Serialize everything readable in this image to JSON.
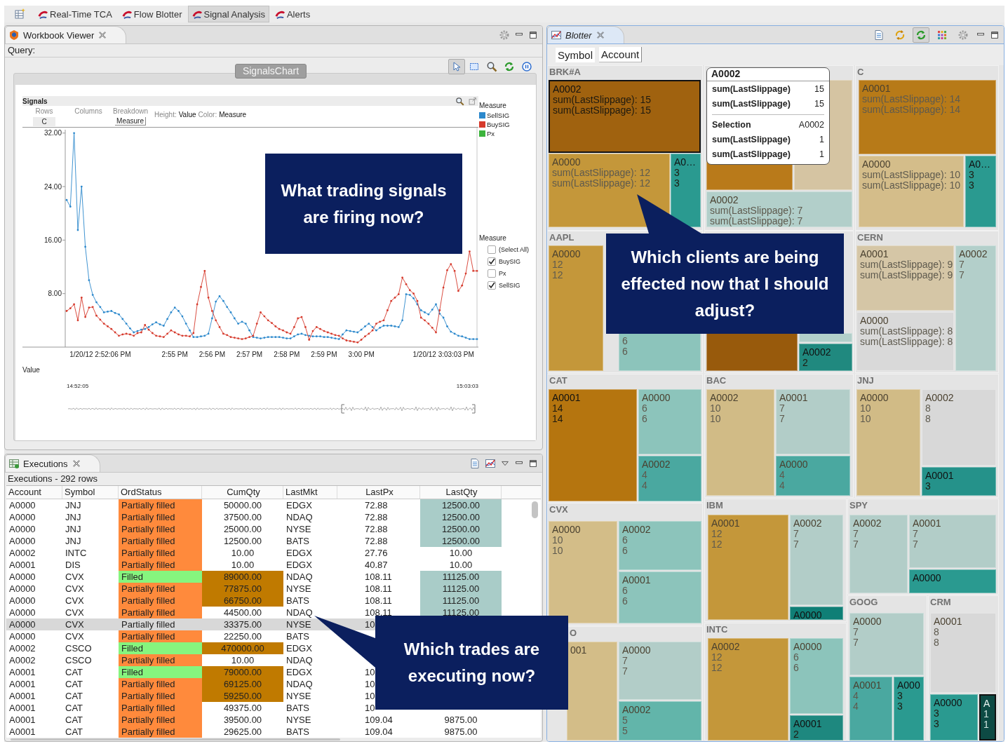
{
  "app_tabs": [
    {
      "label": "Real-Time TCA",
      "selected": false
    },
    {
      "label": "Flow Blotter",
      "selected": false
    },
    {
      "label": "Signal Analysis",
      "selected": true
    },
    {
      "label": "Alerts",
      "selected": false
    }
  ],
  "workbook": {
    "title": "Workbook Viewer",
    "query_label": "Query:",
    "chart_button": "SignalsChart",
    "toolbar": [
      {
        "kind": "pointer",
        "selected": true
      },
      {
        "kind": "marquee",
        "selected": false
      },
      {
        "kind": "search",
        "selected": false
      },
      {
        "kind": "refresh",
        "selected": false
      },
      {
        "kind": "pause",
        "selected": false
      }
    ],
    "chart": {
      "title": "Signals",
      "rows_label": "Rows",
      "rows_value": "C",
      "columns_label": "Columns",
      "breakdown_label": "Breakdown",
      "breakdown_value": "Measure",
      "height_label": "Height:",
      "height_value": "Value",
      "color_label": "Color:",
      "color_value": "Measure",
      "legend_title": "Measure",
      "filter_title": "Measure",
      "filter": [
        {
          "label": "(Select All)",
          "checked": false
        },
        {
          "label": "BuySIG",
          "checked": true
        },
        {
          "label": "Px",
          "checked": false
        },
        {
          "label": "SellSIG",
          "checked": true
        }
      ],
      "value_label": "Value",
      "overview_start": "14:52:05",
      "overview_end": "15:03:03",
      "chart_data": {
        "type": "line",
        "ylim": [
          0,
          32.5
        ],
        "categories": [
          null,
          null,
          null,
          null,
          null,
          null,
          null,
          null,
          null,
          "1/20/12 2:52:06 PM",
          null,
          null,
          null,
          null,
          null,
          null,
          null,
          null,
          null,
          null,
          null,
          null,
          null,
          null,
          null,
          null,
          null,
          null,
          null,
          "2:55 PM",
          null,
          null,
          null,
          null,
          null,
          null,
          null,
          null,
          null,
          "2:56 PM",
          null,
          null,
          null,
          null,
          null,
          null,
          null,
          null,
          null,
          "2:57 PM",
          null,
          null,
          null,
          null,
          null,
          null,
          null,
          null,
          null,
          "2:58 PM",
          null,
          null,
          null,
          null,
          null,
          null,
          null,
          null,
          null,
          "2:59 PM",
          null,
          null,
          null,
          null,
          null,
          null,
          null,
          null,
          null,
          "3:00 PM",
          null,
          null,
          null,
          null,
          null,
          null,
          null,
          null,
          null,
          null,
          null,
          null,
          null,
          null,
          null,
          null,
          null,
          null,
          null,
          null,
          null,
          "1/20/12 3:03:03 PM",
          null,
          null,
          null,
          null,
          null,
          null,
          null,
          null,
          null
        ],
        "yticks": [
          {
            "value": 8,
            "label": "8.00"
          },
          {
            "value": 16,
            "label": "16.00"
          },
          {
            "value": 24,
            "label": "24.00"
          },
          {
            "value": 32,
            "label": "32.00"
          }
        ],
        "series": [
          {
            "name": "SellSIG",
            "color": "#2b88cc",
            "values": [
              22,
              21,
              32,
              17.5,
              24,
              15,
              10,
              7.8,
              6.7,
              6,
              5.2,
              5.3,
              5.4,
              5.1,
              4.9,
              4.2,
              3.5,
              2.8,
              2.2,
              2.4,
              2.6,
              2.7,
              3,
              3.4,
              3.7,
              3.4,
              3.2,
              4.2,
              5.2,
              5.9,
              5.4,
              4.6,
              3.5,
              2.5,
              1.5,
              1.5,
              1.6,
              1.7,
              2,
              4.3,
              6.8,
              7.6,
              6.9,
              6,
              5.2,
              4.3,
              3.5,
              3.8,
              3.5,
              2.5,
              1.5,
              1.4,
              1.3,
              1.4,
              1.5,
              1.5,
              1.5,
              1.5,
              1.4,
              1.3,
              1.3,
              1.6,
              1.9,
              2,
              1.8,
              1.7,
              1.6,
              1.6,
              1.6,
              1.5,
              1.5,
              1.4,
              1.3,
              1.2,
              1.9,
              2.5,
              2.4,
              2.3,
              2.2,
              2.6,
              3.1,
              3.5,
              3,
              2.5,
              2.9,
              3.2,
              3.2,
              3.2,
              3.1,
              3,
              4,
              7.9,
              7.8,
              7.3,
              6.4,
              5.5,
              5.2,
              4.9,
              5.6,
              6.4,
              5.0,
              4.4,
              3.1,
              2.3,
              2,
              1.7,
              1.6,
              1.4,
              1.2,
              1.2,
              1.2
            ]
          },
          {
            "name": "BuySIG",
            "color": "#d63a2c",
            "values": [
              5.4,
              5.8,
              6.4,
              4,
              7.4,
              4.5,
              5.9,
              6,
              4.7,
              4.1,
              3.5,
              3.1,
              2.7,
              2.2,
              1.7,
              1.9,
              2,
              1.9,
              1.7,
              2.1,
              2.2,
              3.3,
              2.6,
              2.1,
              1.7,
              1.6,
              1.5,
              2,
              2.5,
              2.2,
              1.9,
              1.7,
              1.7,
              1.6,
              2.1,
              6.4,
              9,
              11.4,
              7.4,
              5.4,
              4,
              3,
              2,
              1.8,
              1.5,
              1.4,
              1.3,
              1.2,
              1.3,
              1.5,
              1.7,
              3.5,
              5.2,
              4.6,
              4,
              3.6,
              3.1,
              2.7,
              2.5,
              2.2,
              2,
              3,
              4.3,
              4.5,
              3,
              1.1,
              2.4,
              3,
              2.7,
              2.4,
              2.2,
              2,
              1.8,
              1.7,
              1.3,
              1,
              0.9,
              0.8,
              0.7,
              1.1,
              1.6,
              2,
              2.5,
              3.5,
              3.8,
              4,
              5.5,
              6.9,
              7.4,
              7.9,
              10.4,
              9.4,
              8.5,
              8.0,
              6.9,
              4.4,
              4,
              3.5,
              2.9,
              2.2,
              5.5,
              8.9,
              11.5,
              12.4,
              11.4,
              8.4,
              9.2,
              11,
              14.3,
              11.4,
              11.4
            ]
          },
          {
            "name": "Px",
            "color": "#3cb43c",
            "values": [
              null,
              null,
              null,
              null,
              null,
              null,
              null,
              null,
              null,
              null,
              null,
              null,
              null,
              null,
              null,
              null,
              null,
              null,
              null,
              null,
              null,
              null,
              null,
              null,
              null,
              null,
              null,
              null,
              null,
              null,
              null,
              null,
              null,
              null,
              null,
              null,
              null,
              null,
              null,
              null,
              null,
              null,
              null,
              null,
              null,
              null,
              null,
              null,
              null,
              null,
              null,
              null,
              null,
              null,
              null,
              null,
              null,
              null,
              null,
              null,
              null,
              null,
              null,
              null,
              null,
              null,
              null,
              null,
              null,
              null,
              null,
              null,
              null,
              null,
              null,
              null,
              null,
              null,
              null,
              null,
              null,
              null,
              null,
              null,
              null,
              null,
              null,
              null,
              null,
              null,
              null,
              null,
              null,
              null,
              null,
              null,
              null,
              null,
              null,
              null,
              null,
              null,
              null,
              null,
              null,
              null,
              null,
              null,
              null,
              null,
              null
            ]
          }
        ]
      }
    }
  },
  "executions": {
    "title": "Executions",
    "caption": "Executions - 292 rows",
    "columns": [
      "Account",
      "Symbol",
      "OrdStatus",
      "CumQty",
      "LastMkt",
      "LastPx",
      "LastQty"
    ],
    "rows": [
      {
        "selected": false,
        "cells": [
          {
            "text": "A0000"
          },
          {
            "text": "JNJ"
          },
          {
            "text": "Partially filled",
            "color": "#ff8a3c"
          },
          {
            "text": "50000.00"
          },
          {
            "text": "EDGX"
          },
          {
            "text": "72.88"
          },
          {
            "text": "12500.00",
            "color": "#a9ccc8"
          }
        ]
      },
      {
        "selected": false,
        "cells": [
          {
            "text": "A0000"
          },
          {
            "text": "JNJ"
          },
          {
            "text": "Partially filled",
            "color": "#ff8a3c"
          },
          {
            "text": "37500.00"
          },
          {
            "text": "NDAQ"
          },
          {
            "text": "72.88"
          },
          {
            "text": "12500.00",
            "color": "#a9ccc8"
          }
        ]
      },
      {
        "selected": false,
        "cells": [
          {
            "text": "A0000"
          },
          {
            "text": "JNJ"
          },
          {
            "text": "Partially filled",
            "color": "#ff8a3c"
          },
          {
            "text": "25000.00"
          },
          {
            "text": "NYSE"
          },
          {
            "text": "72.88"
          },
          {
            "text": "12500.00",
            "color": "#a9ccc8"
          }
        ]
      },
      {
        "selected": false,
        "cells": [
          {
            "text": "A0000"
          },
          {
            "text": "JNJ"
          },
          {
            "text": "Partially filled",
            "color": "#ff8a3c"
          },
          {
            "text": "12500.00"
          },
          {
            "text": "BATS"
          },
          {
            "text": "72.88"
          },
          {
            "text": "12500.00",
            "color": "#a9ccc8"
          }
        ]
      },
      {
        "selected": false,
        "cells": [
          {
            "text": "A0002"
          },
          {
            "text": "INTC"
          },
          {
            "text": "Partially filled",
            "color": "#ff8a3c"
          },
          {
            "text": "10.00"
          },
          {
            "text": "EDGX"
          },
          {
            "text": "27.76"
          },
          {
            "text": "10.00"
          }
        ]
      },
      {
        "selected": false,
        "cells": [
          {
            "text": "A0001"
          },
          {
            "text": "DIS"
          },
          {
            "text": "Partially filled",
            "color": "#ff8a3c"
          },
          {
            "text": "10.00"
          },
          {
            "text": "EDGX"
          },
          {
            "text": "40.87"
          },
          {
            "text": "10.00"
          }
        ]
      },
      {
        "selected": false,
        "cells": [
          {
            "text": "A0000"
          },
          {
            "text": "CVX"
          },
          {
            "text": "Filled",
            "color": "#86f57e"
          },
          {
            "text": "89000.00",
            "color": "#c07a00"
          },
          {
            "text": "NDAQ"
          },
          {
            "text": "108.11"
          },
          {
            "text": "11125.00",
            "color": "#a9ccc8"
          }
        ]
      },
      {
        "selected": false,
        "cells": [
          {
            "text": "A0000"
          },
          {
            "text": "CVX"
          },
          {
            "text": "Partially filled",
            "color": "#ff8a3c"
          },
          {
            "text": "77875.00",
            "color": "#c07a00"
          },
          {
            "text": "NYSE"
          },
          {
            "text": "108.11"
          },
          {
            "text": "11125.00",
            "color": "#a9ccc8"
          }
        ]
      },
      {
        "selected": false,
        "cells": [
          {
            "text": "A0000"
          },
          {
            "text": "CVX"
          },
          {
            "text": "Partially filled",
            "color": "#ff8a3c"
          },
          {
            "text": "66750.00",
            "color": "#c07a00"
          },
          {
            "text": "BATS"
          },
          {
            "text": "108.11"
          },
          {
            "text": "11125.00",
            "color": "#a9ccc8"
          }
        ]
      },
      {
        "selected": false,
        "cells": [
          {
            "text": "A0000"
          },
          {
            "text": "CVX"
          },
          {
            "text": "Partially filled",
            "color": "#ff8a3c"
          },
          {
            "text": "44500.00"
          },
          {
            "text": "NDAQ"
          },
          {
            "text": "108.11"
          },
          {
            "text": "11125.00",
            "color": "#a9ccc8"
          }
        ]
      },
      {
        "selected": true,
        "cells": [
          {
            "text": "A0000"
          },
          {
            "text": "CVX"
          },
          {
            "text": "Partially filled"
          },
          {
            "text": "33375.00"
          },
          {
            "text": "NYSE"
          },
          {
            "text": "10"
          },
          null
        ]
      },
      {
        "selected": false,
        "cells": [
          {
            "text": "A0000"
          },
          {
            "text": "CVX"
          },
          {
            "text": "Partially filled",
            "color": "#ff8a3c"
          },
          {
            "text": "22250.00"
          },
          {
            "text": "BATS"
          },
          null,
          null
        ]
      },
      {
        "selected": false,
        "cells": [
          {
            "text": "A0002"
          },
          {
            "text": "CSCO"
          },
          {
            "text": "Filled",
            "color": "#86f57e"
          },
          {
            "text": "470000.00",
            "color": "#c07a00"
          },
          {
            "text": "EDGX"
          },
          null,
          null
        ]
      },
      {
        "selected": false,
        "cells": [
          {
            "text": "A0002"
          },
          {
            "text": "CSCO"
          },
          {
            "text": "Partially filled",
            "color": "#ff8a3c"
          },
          {
            "text": "10.00"
          },
          {
            "text": "NDAQ"
          },
          null,
          null
        ]
      },
      {
        "selected": false,
        "cells": [
          {
            "text": "A0001"
          },
          {
            "text": "CAT"
          },
          {
            "text": "Filled",
            "color": "#86f57e"
          },
          {
            "text": "79000.00",
            "color": "#c07a00"
          },
          {
            "text": "EDGX"
          },
          {
            "text": "10"
          },
          null
        ]
      },
      {
        "selected": false,
        "cells": [
          {
            "text": "A0001"
          },
          {
            "text": "CAT"
          },
          {
            "text": "Partially filled",
            "color": "#ff8a3c"
          },
          {
            "text": "69125.00",
            "color": "#c07a00"
          },
          {
            "text": "NDAQ"
          },
          {
            "text": "10"
          },
          null
        ]
      },
      {
        "selected": false,
        "cells": [
          {
            "text": "A0001"
          },
          {
            "text": "CAT"
          },
          {
            "text": "Partially filled",
            "color": "#ff8a3c"
          },
          {
            "text": "59250.00",
            "color": "#c07a00"
          },
          {
            "text": "NYSE"
          },
          {
            "text": "10"
          },
          null
        ]
      },
      {
        "selected": false,
        "cells": [
          {
            "text": "A0001"
          },
          {
            "text": "CAT"
          },
          {
            "text": "Partially filled",
            "color": "#ff8a3c"
          },
          {
            "text": "49375.00"
          },
          {
            "text": "BATS"
          },
          {
            "text": "10"
          },
          null
        ]
      },
      {
        "selected": false,
        "cells": [
          {
            "text": "A0001"
          },
          {
            "text": "CAT"
          },
          {
            "text": "Partially filled",
            "color": "#ff8a3c"
          },
          {
            "text": "39500.00"
          },
          {
            "text": "NYSE"
          },
          {
            "text": "109.04"
          },
          {
            "text": "9875.00"
          }
        ]
      },
      {
        "selected": false,
        "cells": [
          {
            "text": "A0001"
          },
          {
            "text": "CAT"
          },
          {
            "text": "Partially filled",
            "color": "#ff8a3c"
          },
          {
            "text": "29625.00"
          },
          {
            "text": "BATS"
          },
          {
            "text": "109.04"
          },
          {
            "text": "9875.00"
          }
        ]
      }
    ]
  },
  "blotter": {
    "title": "Blotter",
    "toolbar": [
      {
        "kind": "layout",
        "selected": false
      },
      {
        "kind": "sync",
        "selected": false
      },
      {
        "kind": "refresh",
        "selected": true
      },
      {
        "kind": "colors",
        "selected": false
      },
      {
        "kind": "settings",
        "selected": false
      }
    ],
    "levels": [
      "Symbol",
      "Account"
    ],
    "tooltip": {
      "title": "A0002",
      "top_rows": [
        {
          "label": "sum(LastSlippage)",
          "value": "15"
        },
        {
          "label": "sum(LastSlippage)",
          "value": "15"
        }
      ],
      "selection_label": "Selection",
      "selection_value": "A0002",
      "bottom_rows": [
        {
          "label": "sum(LastSlippage)",
          "value": "1"
        },
        {
          "label": "sum(LastSlippage)",
          "value": "1"
        }
      ]
    },
    "groups": [
      {
        "name": "BRK#A",
        "tiles": [
          {
            "label": "A0002",
            "values": [
              "sum(LastSlippage): 15",
              "sum(LastSlippage): 15"
            ],
            "color": "#a0620f",
            "selected": true
          },
          {
            "label": "A0000",
            "values": [
              "sum(LastSlippage): 12",
              "sum(LastSlippage): 12"
            ],
            "color": "#c4973a",
            "selected": false
          },
          {
            "label": "A0…",
            "values": [
              "3",
              "3"
            ],
            "color": "#2a9a90",
            "selected": false
          }
        ]
      },
      {
        "tiles": [
          {
            "color": "#b97a1a",
            "selected": false
          },
          {
            "color": "#d5c4a2",
            "selected": false
          },
          {
            "label": "A0002",
            "values": [
              "sum(LastSlippage): 7",
              "sum(LastSlippage): 7"
            ],
            "color": "#b2cfca",
            "selected": false
          }
        ]
      },
      {
        "name": "C",
        "tiles": [
          {
            "label": "A0001",
            "values": [
              "sum(LastSlippage): 14",
              "sum(LastSlippage): 14"
            ],
            "color": "#b77a18",
            "selected": false
          },
          {
            "label": "A0000",
            "values": [
              "sum(LastSlippage): 10",
              "sum(LastSlippage): 10"
            ],
            "color": "#d4bd8a",
            "selected": false
          },
          {
            "label": "A0…",
            "values": [
              "3",
              "3"
            ],
            "color": "#2a9a90",
            "selected": false
          }
        ]
      },
      {
        "name": "AAPL",
        "tiles": [
          {
            "label": "A0000",
            "values": [
              "12",
              "12"
            ],
            "color": "#c4973a",
            "selected": false
          },
          {
            "values": [
              "6",
              "6"
            ],
            "color": "#8cc4bb",
            "selected": false
          }
        ]
      },
      {
        "tiles": [
          {
            "color": "#985a0c",
            "selected": false
          },
          {
            "color": "#b2cfca",
            "selected": false
          },
          {
            "label": "A0002",
            "values": [
              "2"
            ],
            "color": "#20897f",
            "selected": false
          }
        ]
      },
      {
        "name": "CERN",
        "tiles": [
          {
            "label": "A0001",
            "values": [
              "sum(LastSlippage): 9",
              "sum(LastSlippage): 9"
            ],
            "color": "#d5c6a6",
            "selected": false
          },
          {
            "label": "A0000",
            "values": [
              "sum(LastSlippage): 8",
              "sum(LastSlippage): 8"
            ],
            "color": "#d9d9d9",
            "selected": false
          },
          {
            "label": "A0002",
            "values": [
              "7",
              "7"
            ],
            "color": "#b3cfca",
            "selected": false
          }
        ]
      },
      {
        "name": "CAT",
        "tiles": [
          {
            "label": "A0001",
            "values": [
              "14",
              "14"
            ],
            "color": "#b5750f",
            "selected": false
          },
          {
            "label": "A0000",
            "values": [
              "6",
              "6"
            ],
            "color": "#8cc4bb",
            "selected": false
          },
          {
            "label": "A0002",
            "values": [
              "4",
              "4"
            ],
            "color": "#4aa8a0",
            "selected": false
          }
        ]
      },
      {
        "name": "BAC",
        "tiles": [
          {
            "label": "A0002",
            "values": [
              "10",
              "10"
            ],
            "color": "#d1bb86",
            "selected": false
          },
          {
            "label": "A0001",
            "values": [
              "7",
              "7"
            ],
            "color": "#b2cdc8",
            "selected": false
          },
          {
            "label": "A0000",
            "values": [
              "4",
              "4"
            ],
            "color": "#4aa8a0",
            "selected": false
          }
        ]
      },
      {
        "name": "JNJ",
        "tiles": [
          {
            "label": "A0000",
            "values": [
              "10",
              "10"
            ],
            "color": "#d1bb86",
            "selected": false
          },
          {
            "label": "A0002",
            "values": [
              "8",
              "8"
            ],
            "color": "#d8d8d8",
            "selected": false
          },
          {
            "label": "A0001",
            "values": [
              "3"
            ],
            "color": "#25928a",
            "selected": false
          }
        ]
      },
      {
        "name": "CVX",
        "tiles": [
          {
            "label": "A0000",
            "values": [
              "10",
              "10"
            ],
            "color": "#d3bd88",
            "selected": false
          },
          {
            "label": "A0002",
            "values": [
              "6",
              "6"
            ],
            "color": "#8cc4bb",
            "selected": false
          },
          {
            "label": "A0001",
            "values": [
              "6",
              "6"
            ],
            "color": "#8cc4bb",
            "selected": false
          }
        ]
      },
      {
        "name": "O",
        "tiles": [
          {
            "label": "001",
            "color": "#d3bd88",
            "selected": false
          },
          {
            "label": "A0000",
            "values": [
              "7",
              "7"
            ],
            "color": "#b2cdc8",
            "selected": false
          },
          {
            "label": "A0002",
            "values": [
              "5",
              "5"
            ],
            "color": "#62b5aa",
            "selected": false
          }
        ]
      },
      {
        "name": "IBM",
        "tiles": [
          {
            "label": "A0001",
            "values": [
              "12",
              "12"
            ],
            "color": "#c4973a",
            "selected": false
          },
          {
            "label": "A0002",
            "values": [
              "7",
              "7"
            ],
            "color": "#b2cdc8",
            "selected": false
          },
          {
            "label": "A0000",
            "color": "#0f7f76",
            "selected": false
          }
        ]
      },
      {
        "name": "INTC",
        "tiles": [
          {
            "label": "A0002",
            "values": [
              "12",
              "12"
            ],
            "color": "#c4973a",
            "selected": false
          },
          {
            "label": "A0000",
            "values": [
              "6",
              "6"
            ],
            "color": "#8cc4bb",
            "selected": false
          },
          {
            "label": "A0001",
            "values": [
              "2"
            ],
            "color": "#1e887f",
            "selected": false
          }
        ]
      },
      {
        "name": "SPY",
        "tiles": [
          {
            "label": "A0002",
            "values": [
              "7",
              "7"
            ],
            "color": "#b2cdc8",
            "selected": false
          },
          {
            "label": "A0001",
            "values": [
              "7",
              "7"
            ],
            "color": "#b2cdc8",
            "selected": false
          },
          {
            "label": "A0000",
            "color": "#2a9a90",
            "selected": false
          }
        ]
      },
      {
        "name": "GOOG",
        "tiles": [
          {
            "label": "A0000",
            "values": [
              "7",
              "7"
            ],
            "color": "#b2cdc8",
            "selected": false
          },
          {
            "label": "A0001",
            "values": [
              "4",
              "4"
            ],
            "color": "#4aa8a0",
            "selected": false
          },
          {
            "label": "A000",
            "values": [
              "3",
              "3"
            ],
            "color": "#2a9a90",
            "selected": false
          }
        ]
      },
      {
        "name": "CRM",
        "tiles": [
          {
            "label": "A0001",
            "values": [
              "8",
              "8"
            ],
            "color": "#d8d8d8",
            "selected": false
          },
          {
            "label": "A0000",
            "values": [
              "3",
              "3"
            ],
            "color": "#2a9a90",
            "selected": false
          },
          {
            "label": "A",
            "values": [
              "1",
              "1"
            ],
            "color": "#0d4a44",
            "selected": true
          }
        ]
      }
    ]
  },
  "callouts": [
    {
      "text": "What trading signals are firing now?"
    },
    {
      "text": "Which clients are being effected now that I should adjust?"
    },
    {
      "text": "Which trades are executing now?"
    }
  ]
}
